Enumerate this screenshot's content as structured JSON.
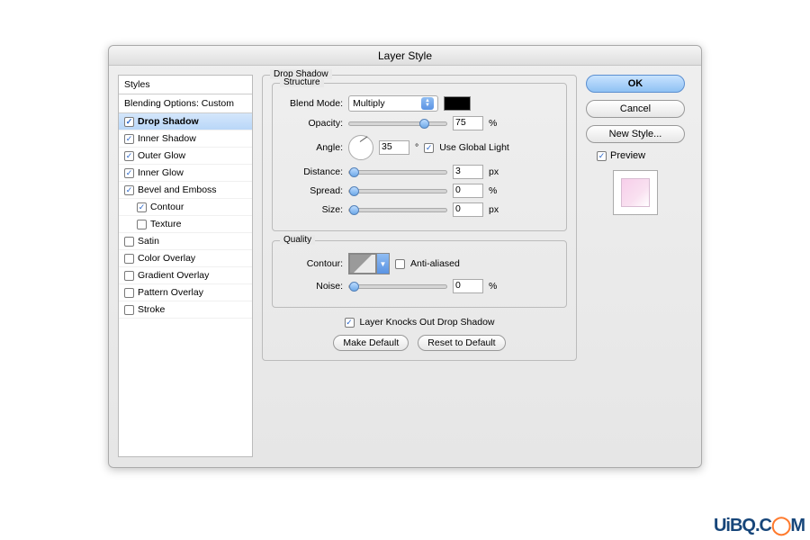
{
  "dialog": {
    "title": "Layer Style"
  },
  "sidebar": {
    "styles_header": "Styles",
    "blending_header": "Blending Options: Custom",
    "items": [
      {
        "label": "Drop Shadow",
        "checked": true,
        "selected": true
      },
      {
        "label": "Inner Shadow",
        "checked": true
      },
      {
        "label": "Outer Glow",
        "checked": true
      },
      {
        "label": "Inner Glow",
        "checked": true
      },
      {
        "label": "Bevel and Emboss",
        "checked": true
      },
      {
        "label": "Contour",
        "checked": true,
        "sub": true
      },
      {
        "label": "Texture",
        "checked": false,
        "sub": true
      },
      {
        "label": "Satin",
        "checked": false
      },
      {
        "label": "Color Overlay",
        "checked": false
      },
      {
        "label": "Gradient Overlay",
        "checked": false
      },
      {
        "label": "Pattern Overlay",
        "checked": false
      },
      {
        "label": "Stroke",
        "checked": false
      }
    ]
  },
  "panel": {
    "title": "Drop Shadow",
    "structure_title": "Structure",
    "quality_title": "Quality",
    "blend_mode_label": "Blend Mode:",
    "blend_mode_value": "Multiply",
    "opacity_label": "Opacity:",
    "opacity_value": "75",
    "opacity_unit": "%",
    "angle_label": "Angle:",
    "angle_value": "35",
    "angle_unit": "°",
    "use_global_label": "Use Global Light",
    "distance_label": "Distance:",
    "distance_value": "3",
    "distance_unit": "px",
    "spread_label": "Spread:",
    "spread_value": "0",
    "spread_unit": "%",
    "size_label": "Size:",
    "size_value": "0",
    "size_unit": "px",
    "contour_label": "Contour:",
    "anti_aliased_label": "Anti-aliased",
    "noise_label": "Noise:",
    "noise_value": "0",
    "noise_unit": "%",
    "knocks_out_label": "Layer Knocks Out Drop Shadow",
    "make_default": "Make Default",
    "reset_default": "Reset to Default"
  },
  "actions": {
    "ok": "OK",
    "cancel": "Cancel",
    "new_style": "New Style...",
    "preview": "Preview"
  },
  "watermark": "UiBQ.C   M"
}
